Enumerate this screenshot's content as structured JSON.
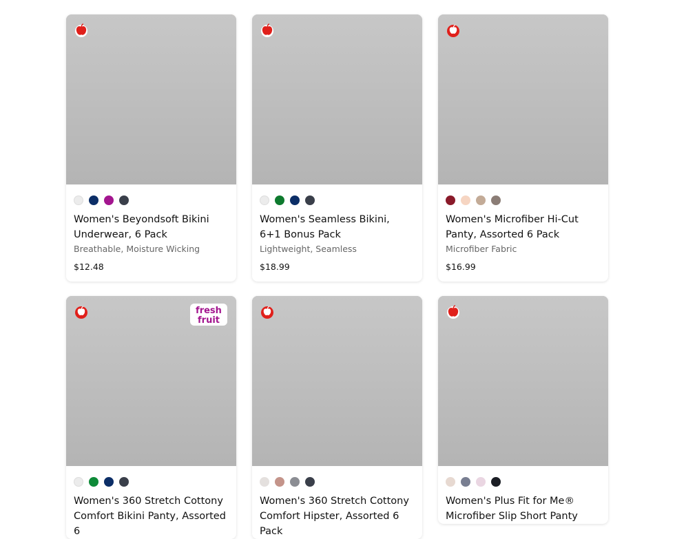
{
  "products": [
    {
      "title_line1": "Women's Beyondsoft Bikini",
      "title_line2": "Underwear, 6 Pack",
      "subtitle": "Breathable, Moisture Wicking",
      "price": "$12.48",
      "badge_icon": "apple-filled-icon",
      "swatches": [
        "#ececec",
        "#0c2e67",
        "#a3158f",
        "#3a3f4a"
      ]
    },
    {
      "title_line1": "Women's Seamless Bikini,",
      "title_line2": "6+1 Bonus Pack",
      "subtitle": "Lightweight, Seamless",
      "price": "$18.99",
      "badge_icon": "apple-filled-icon",
      "swatches": [
        "#ececec",
        "#0e7a2e",
        "#0c2e67",
        "#3a3f4a"
      ]
    },
    {
      "title_line1": "Women's Microfiber Hi-Cut",
      "title_line2": "Panty, Assorted 6 Pack",
      "subtitle": "Microfiber Fabric",
      "price": "$16.99",
      "badge_icon": "apple-outline-icon",
      "swatches": [
        "#8a1a2a",
        "#f6d5c2",
        "#c3ab97",
        "#8b7d76"
      ]
    },
    {
      "title_line1": "Women's 360 Stretch Cottony",
      "title_line2": "Comfort Bikini Panty, Assorted 6",
      "subtitle": "",
      "price": "",
      "badge_icon": "apple-outline-icon",
      "fresh_text": [
        "fresh",
        "fruit"
      ],
      "swatches": [
        "#ececec",
        "#0e8a38",
        "#0c2e67",
        "#3a3f4a"
      ]
    },
    {
      "title_line1": "Women's 360 Stretch Cottony",
      "title_line2": "Comfort Hipster, Assorted 6 Pack",
      "subtitle": "",
      "price": "",
      "badge_icon": "apple-outline-icon",
      "swatches": [
        "#e4e0de",
        "#c4948a",
        "#8b8d93",
        "#3a3f4a"
      ]
    },
    {
      "title_line1": "Women's Plus Fit for Me®",
      "title_line2": "Microfiber Slip Short Panty",
      "subtitle": "",
      "price": "",
      "badge_icon": "apple-filled-icon",
      "swatches": [
        "#e7d9d1",
        "#787e91",
        "#ead6e2",
        "#1b1e25"
      ]
    }
  ]
}
